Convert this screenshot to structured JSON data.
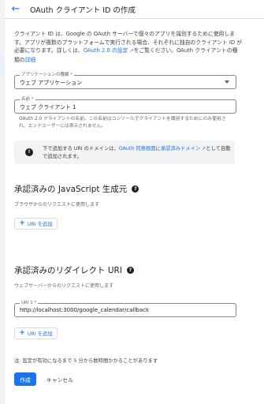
{
  "header": {
    "back_icon": "arrow-back-icon",
    "title": "OAuth クライアント ID の作成"
  },
  "intro": {
    "text": "クライアント ID は、Google の OAuth サーバーで個々のアプリを識別するために使用します。アプリが複数のプラットフォームで実行される場合、それぞれに独自のクライアント ID が必要になります。詳しくは、",
    "link1": "OAuth 2.0 の設定",
    "mid": "をご覧ください。OAuth クライアントの種類の",
    "link2": "詳細"
  },
  "app_type": {
    "label": "アプリケーションの種類 *",
    "value": "ウェブ アプリケーション"
  },
  "name_field": {
    "label": "名前 *",
    "value": "ウェブ クライアント 1",
    "hint": "OAuth 2.0 クライアントの名前。この名前はコンソールでクライアントを識別するためにのみ使用され、エンドユーザーには表示されません。"
  },
  "info": {
    "text_before": "下で追加する URI のドメインは、",
    "link1": "OAuth 同意画面",
    "text_mid": "に",
    "link2": "承認済みドメイン",
    "text_after": "として自動で追加されます。"
  },
  "js_origins": {
    "title": "承認済みの JavaScript 生成元",
    "subtitle": "ブラウザからのリクエストに使用します",
    "add_label": "URI を追加"
  },
  "redirect_uris": {
    "title": "承認済みのリダイレクト URI",
    "subtitle": "ウェブサーバーからのリクエストに使用します",
    "uri_label": "URI 1 *",
    "uri_value": "http://localhost:3000/google_calendar/callback",
    "add_label": "URI を追加"
  },
  "footer": {
    "note": "注: 設定が有効になるまで 5 分から数時間かかることがあります",
    "create_label": "作成",
    "cancel_label": "キャンセル"
  },
  "colors": {
    "accent": "#1a73e8",
    "text": "#202124",
    "muted": "#5f6368"
  }
}
